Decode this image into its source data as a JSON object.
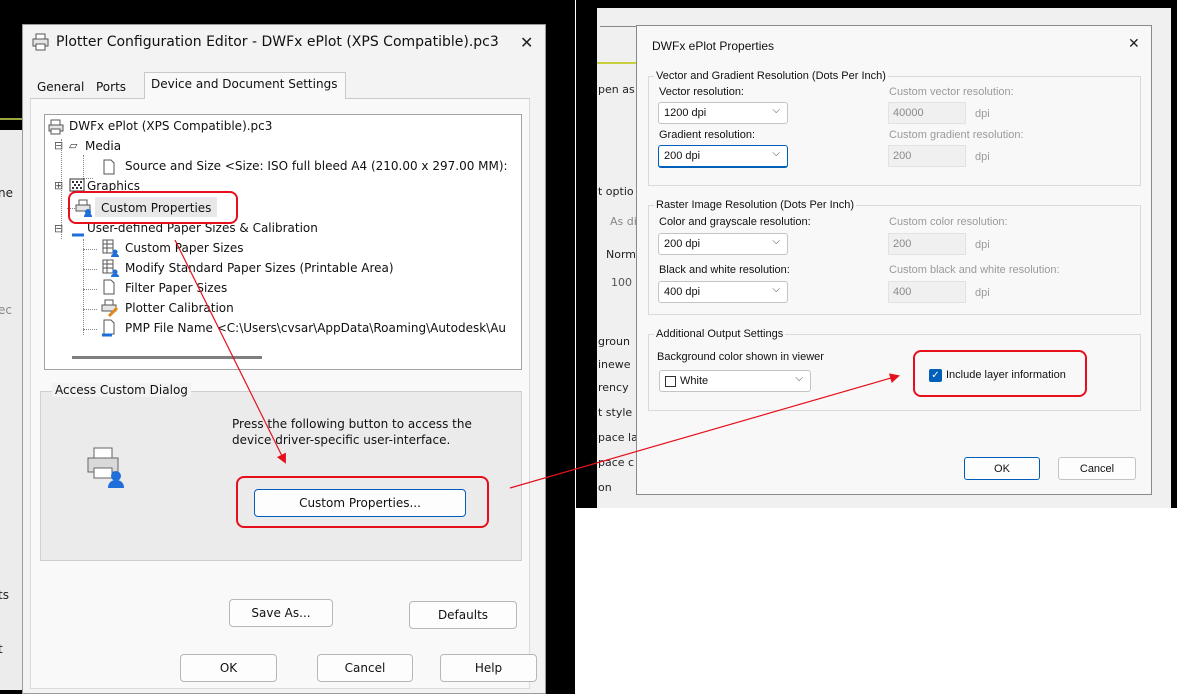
{
  "left_dialog": {
    "title": "Plotter Configuration Editor - DWFx ePlot (XPS Compatible).pc3",
    "close_glyph": "✕",
    "tabs": [
      {
        "label": "General",
        "active": false
      },
      {
        "label": "Ports",
        "active": false
      },
      {
        "label": "Device and Document Settings",
        "active": true
      }
    ],
    "tree": {
      "root": "DWFx ePlot (XPS Compatible).pc3",
      "media": "Media",
      "source_size": "Source and Size <Size: ISO full bleed A4 (210.00 x 297.00 MM):",
      "graphics": "Graphics",
      "custom_properties": "Custom Properties",
      "user_defined": "User-defined Paper Sizes & Calibration",
      "custom_paper_sizes": "Custom Paper Sizes",
      "modify_standard": "Modify Standard Paper Sizes (Printable Area)",
      "filter_paper": "Filter Paper Sizes",
      "plotter_calibration": "Plotter Calibration",
      "pmp_file": "PMP File Name <C:\\Users\\cvsar\\AppData\\Roaming\\Autodesk\\Au",
      "expand_glyph": "⊟",
      "collapse_glyph": "⊞"
    },
    "access_group": {
      "label": "Access Custom Dialog",
      "description": "Press the following button to access the device driver-specific user-interface.",
      "button": "Custom Properties..."
    },
    "save_as": "Save As...",
    "defaults": "Defaults",
    "ok": "OK",
    "cancel": "Cancel",
    "help": "Help"
  },
  "background_fragments": {
    "left": [
      "ne",
      "ec",
      "ts",
      "t"
    ],
    "right": [
      "pen as",
      "t optio",
      "As di",
      "Norm",
      "100",
      "groun",
      "inewe",
      "rency",
      "t style",
      "pace la",
      "pace c",
      "on"
    ]
  },
  "right_dialog": {
    "title": "DWFx ePlot Properties",
    "close_glyph": "✕",
    "vector_group": {
      "label": "Vector and Gradient Resolution (Dots Per Inch)",
      "vector_label": "Vector resolution:",
      "vector_value": "1200 dpi",
      "custom_vector_label": "Custom vector resolution:",
      "custom_vector_value": "40000",
      "gradient_label": "Gradient resolution:",
      "gradient_value": "200 dpi",
      "custom_gradient_label": "Custom gradient resolution:",
      "custom_gradient_value": "200",
      "unit": "dpi"
    },
    "raster_group": {
      "label": "Raster Image Resolution (Dots Per Inch)",
      "color_label": "Color and grayscale resolution:",
      "color_value": "200 dpi",
      "custom_color_label": "Custom color resolution:",
      "custom_color_value": "200",
      "bw_label": "Black and white resolution:",
      "bw_value": "400 dpi",
      "custom_bw_label": "Custom black and white resolution:",
      "custom_bw_value": "400",
      "unit": "dpi"
    },
    "output_group": {
      "label": "Additional Output Settings",
      "bg_color_label": "Background color shown in viewer",
      "bg_color_value": "White",
      "include_layer_label": "Include layer information",
      "include_layer_checked": true
    },
    "ok": "OK",
    "cancel": "Cancel"
  },
  "colors": {
    "annotation_red": "#e5101c",
    "accent_blue": "#005fb8",
    "bg_dark": "#000000"
  }
}
